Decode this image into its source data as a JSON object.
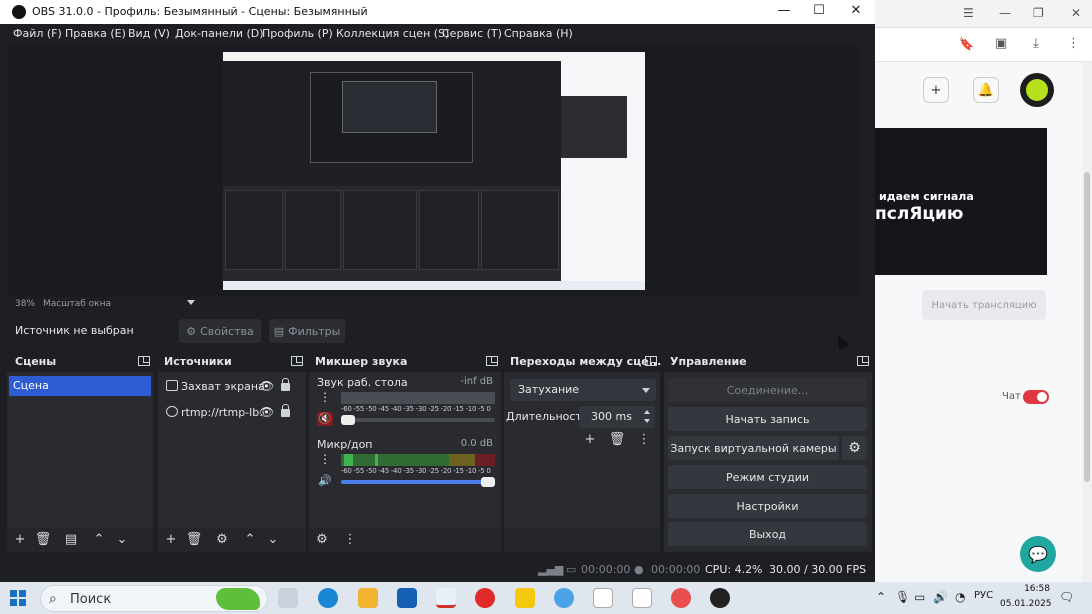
{
  "window": {
    "title": "OBS 31.0.0 - Профиль: Безымянный - Сцены: Безымянный",
    "minimize_icon": "—",
    "maximize_icon": "☐",
    "close_icon": "✕"
  },
  "menu": [
    "Файл (F)",
    "Правка (E)",
    "Вид (V)",
    "Док-панели (D)",
    "Профиль (P)",
    "Коллекция сцен (S)",
    "Сервис (T)",
    "Справка (H)"
  ],
  "preview": {
    "zoom": "38%",
    "zoom_mode": "Масштаб окна"
  },
  "source_bar": {
    "no_source": "Источник не выбран",
    "properties": "Свойства",
    "filters": "Фильтры"
  },
  "docks": {
    "scenes": {
      "title": "Сцены",
      "items": [
        "Сцена"
      ]
    },
    "sources": {
      "title": "Источники",
      "items": [
        "Захват экрана",
        "rtmp://rtmp-lb.c"
      ]
    },
    "mixer": {
      "title": "Микшер звука",
      "channels": [
        {
          "name": "Звук раб. стола",
          "db": "-inf dB",
          "muted": true,
          "volume": 0.05
        },
        {
          "name": "Микр/доп",
          "db": "0.0 dB",
          "muted": false,
          "volume": 1.0
        }
      ],
      "scale": "-60 -55 -50 -45 -40 -35 -30 -25 -20 -15 -10 -5 0"
    },
    "transitions": {
      "title": "Переходы между сце...",
      "selected": "Затухание",
      "duration_label": "Длительность",
      "duration_value": "300 ms"
    },
    "controls": {
      "title": "Управление",
      "buttons": [
        "Соединение...",
        "Начать запись",
        "Запуск виртуальной камеры",
        "Режим студии",
        "Настройки",
        "Выход"
      ]
    }
  },
  "status": {
    "net_time": "00:00:00",
    "rec_time": "00:00:00",
    "cpu": "CPU: 4.2%",
    "fps": "30.00 / 30.00 FPS"
  },
  "browser": {
    "hero_line1": "идаем сигнала",
    "hero_line2": "пслЯцию",
    "start_button": "Начать трансляцию",
    "chat_label": "Чат",
    "chat_on": true
  },
  "taskbar": {
    "search_placeholder": "Поиск",
    "lang": "РУС",
    "time": "16:58",
    "date": "05.01.2025"
  },
  "colors": {
    "obs_bg": "#1e1f24",
    "dock_bg": "#2a2b31",
    "accent": "#2f5bd3",
    "meter_green": "#3fb34f",
    "meter_yellow": "#b9a21c",
    "meter_red": "#b22433",
    "toggle_red": "#e0383e",
    "help_teal": "#1fa7a0"
  }
}
